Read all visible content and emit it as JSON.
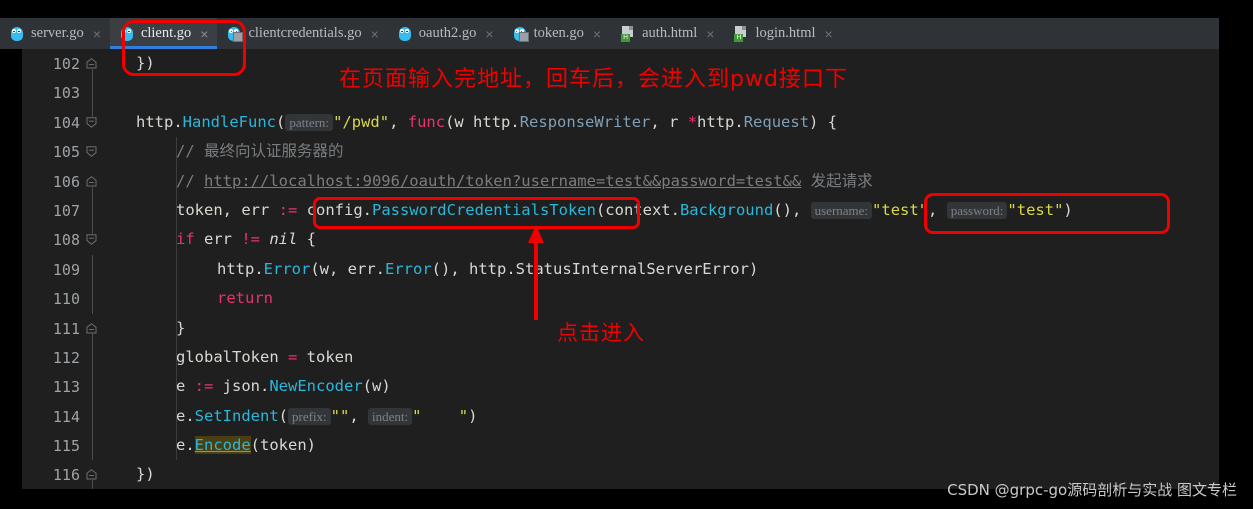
{
  "window": {
    "title": "GoLand editor - client.go"
  },
  "tabs": [
    {
      "label": "server.go",
      "icon": "go-file-icon",
      "active": false,
      "close": "×"
    },
    {
      "label": "client.go",
      "icon": "go-file-icon",
      "active": true,
      "close": "×"
    },
    {
      "label": "clientcredentials.go",
      "icon": "go-library-file-icon",
      "active": false,
      "close": "×"
    },
    {
      "label": "oauth2.go",
      "icon": "go-file-icon",
      "active": false,
      "close": "×"
    },
    {
      "label": "token.go",
      "icon": "go-library-file-icon",
      "active": false,
      "close": "×"
    },
    {
      "label": "auth.html",
      "icon": "html-file-icon",
      "active": false,
      "close": "×"
    },
    {
      "label": "login.html",
      "icon": "html-file-icon",
      "active": false,
      "close": "×"
    }
  ],
  "editor": {
    "first_line": 102,
    "lines": [
      {
        "num": "102",
        "fold": "collapse-end",
        "code": "102"
      },
      {
        "num": "103",
        "fold": "none",
        "code": "103"
      },
      {
        "num": "104",
        "fold": "collapse-start",
        "code": "104"
      },
      {
        "num": "105",
        "fold": "collapse-start",
        "code": "105"
      },
      {
        "num": "106",
        "fold": "collapse-end",
        "code": "106"
      },
      {
        "num": "107",
        "fold": "none",
        "code": "107"
      },
      {
        "num": "108",
        "fold": "collapse-start",
        "code": "108"
      },
      {
        "num": "109",
        "fold": "none",
        "code": "109"
      },
      {
        "num": "110",
        "fold": "none",
        "code": "110"
      },
      {
        "num": "111",
        "fold": "collapse-end",
        "code": "111"
      },
      {
        "num": "112",
        "fold": "none",
        "code": "112"
      },
      {
        "num": "113",
        "fold": "none",
        "code": "113"
      },
      {
        "num": "114",
        "fold": "none",
        "code": "114"
      },
      {
        "num": "115",
        "fold": "none",
        "code": "115"
      },
      {
        "num": "116",
        "fold": "collapse-end",
        "code": "116"
      }
    ],
    "source": {
      "l102": "})",
      "l104_a": "http.",
      "l104_fn": "HandleFunc",
      "l104_b": "(",
      "l104_hint": "pattern:",
      "l104_str": "\"/pwd\"",
      "l104_c": ", ",
      "l104_kw": "func",
      "l104_d": "(w http.",
      "l104_ty1": "ResponseWriter",
      "l104_e": ", r ",
      "l104_star": "*",
      "l104_f": "http.",
      "l104_ty2": "Request",
      "l104_g": ") {",
      "l105": "// 最终向认证服务器的",
      "l106_a": "// ",
      "l106_url": "http://localhost:9096/oauth/token?username=test&&password=test&&",
      "l106_b": " 发起请求",
      "l107_a": "token, err ",
      "l107_op": ":=",
      "l107_b": " config.",
      "l107_fn": "PasswordCredentialsToken",
      "l107_c": "(context.",
      "l107_fn2": "Background",
      "l107_d": "(), ",
      "l107_hint1": "username:",
      "l107_s1": "\"test\"",
      "l107_e": ", ",
      "l107_hint2": "password:",
      "l107_s2": "\"test\"",
      "l107_f": ")",
      "l108_kw": "if",
      "l108_a": " err ",
      "l108_op": "!=",
      "l108_nil": " nil",
      "l108_b": " {",
      "l109_a": "http.",
      "l109_fn1": "Error",
      "l109_b": "(w, err.",
      "l109_fn2": "Error",
      "l109_c": "(), http.",
      "l109_ty": "StatusInternalServerError",
      "l109_d": ")",
      "l110_kw": "return",
      "l111": "}",
      "l112_a": "globalToken ",
      "l112_op": "=",
      "l112_b": " token",
      "l113_a": "e ",
      "l113_op": ":=",
      "l113_b": " json.",
      "l113_fn": "NewEncoder",
      "l113_c": "(w)",
      "l114_a": "e.",
      "l114_fn": "SetIndent",
      "l114_b": "(",
      "l114_hint1": "prefix:",
      "l114_s1": "\"\"",
      "l114_c": ", ",
      "l114_hint2": "indent:",
      "l114_s2": "\"    \"",
      "l114_d": ")",
      "l115_a": "e.",
      "l115_fn": "Encode",
      "l115_b": "(token)",
      "l116": "})"
    }
  },
  "annotations": {
    "top_note": "在页面输入完地址，回车后，会进入到pwd接口下",
    "click_note": "点击进入",
    "color": "#f10000"
  },
  "watermark": {
    "text": "CSDN @grpc-go源码剖析与实战 图文专栏"
  },
  "theme": {
    "editor_bg": "#1f1f1f",
    "tabbar_bg": "#2f3236",
    "active_tab_bg": "#3b3f43",
    "active_tab_accent": "#2f7fdc",
    "keyword": "#e8336d",
    "function": "#29b8db",
    "string": "#d8d84a",
    "comment": "#7a7d80",
    "plain": "#d8d8d2",
    "type": "#7f9fb8",
    "hover_highlight": "#4a3f12"
  }
}
